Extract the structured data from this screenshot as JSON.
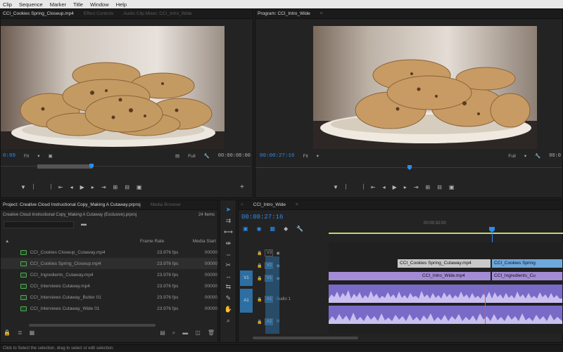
{
  "menu": [
    "Clip",
    "Sequence",
    "Marker",
    "Title",
    "Window",
    "Help"
  ],
  "source": {
    "tabs": [
      "CCI_Cookies Spring_Closeup.mp4",
      "Effect Controls",
      "Audio Clip Mixer: CCI_Intro_Wide"
    ],
    "timecode_in": "0:09",
    "fit": "Fit",
    "full": "Full",
    "timecode_out": "00:00:08:00"
  },
  "program": {
    "tab": "Program: CCI_Intro_Wide",
    "timecode": "00:00:27:16",
    "fit": "Fit",
    "full": "Full",
    "timecode_out": "00:0"
  },
  "project": {
    "title": "Project: Creative Cloud Instructional Copy_Making A Cutaway.prproj",
    "tab2": "Media Browser",
    "path": "Creative Cloud Instructional Copy_Making A Cutaway (Exclusive).prproj",
    "count": "24 Items",
    "headers": {
      "frame": "Frame Rate",
      "media": "Media Start"
    },
    "rows": [
      {
        "name": "CCI_Cookies Closeup_Cutaway.mp4",
        "frame": "23.976 fps",
        "media": "00000"
      },
      {
        "name": "CCI_Cookies Spring_Closeup.mp4",
        "frame": "23.976 fps",
        "media": "00000"
      },
      {
        "name": "CCI_Ingredients_Cutaway.mp4",
        "frame": "23.976 fps",
        "media": "00000"
      },
      {
        "name": "CCI_Interviews Cutaway.mp4",
        "frame": "23.976 fps",
        "media": "00000"
      },
      {
        "name": "CCI_Interviews Cutaway_Butter 01",
        "frame": "23.976 fps",
        "media": "00000"
      },
      {
        "name": "CCI_Interviews Cutaway_Wide 01",
        "frame": "23.976 fps",
        "media": "00000"
      }
    ]
  },
  "timeline": {
    "tab": "CCI_Intro_Wide",
    "timecode": "00:00:27:16",
    "ruler_label": "00:00:32:00",
    "tracks": {
      "v2": "V2",
      "v1": "V1",
      "a1": "A1",
      "a2": "A2",
      "source_v1": "V1",
      "source_a1": "A1",
      "audio_label": "Audio 1"
    },
    "clips": {
      "v2_clip_a": "CCI_Cookies Spring_Cutaway.mp4",
      "v2_clip_b": "CCI_Cookies Spring",
      "v1_clip_a": "CCI_Intro_Wide.mp4",
      "v1_clip_b": "CCI_Ingredients_Cu"
    }
  },
  "status": "Click to Select the selection, drag to select or edit selection.",
  "colors": {
    "accent": "#2d8ceb",
    "video_clip": "#a6a6d9",
    "audio_clip": "#8a7ad6",
    "selected_clip": "#6fa8dc"
  }
}
